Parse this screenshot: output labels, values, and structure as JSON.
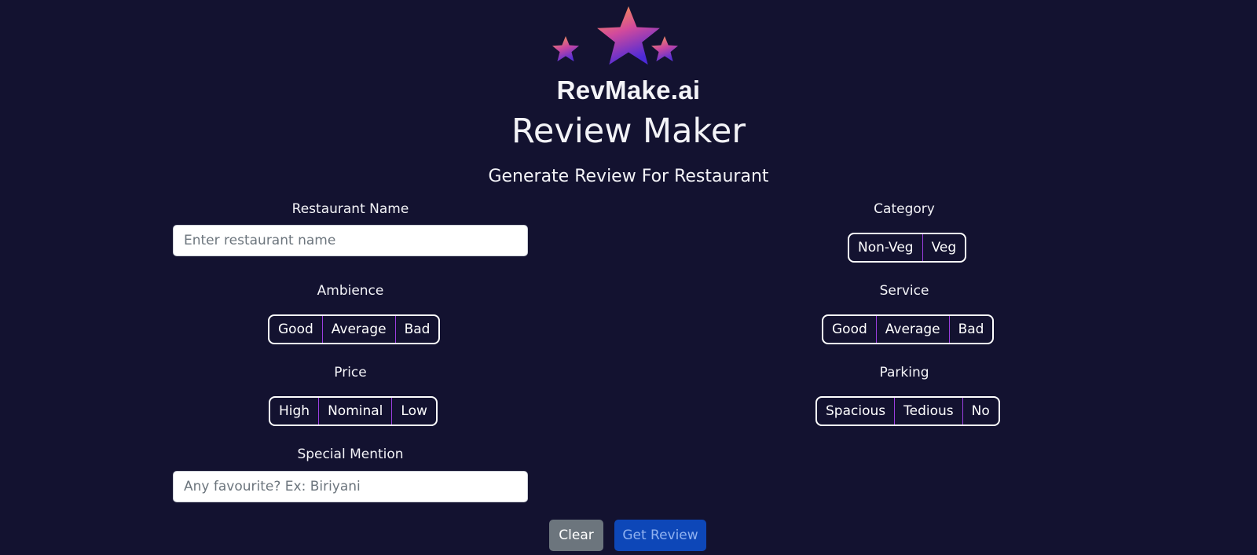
{
  "brand": {
    "name": "RevMake.ai",
    "logo_icon": "three-stars-icon",
    "star_gradient": [
      "#ff9a3c",
      "#c13ea8",
      "#5a2ee0"
    ]
  },
  "header": {
    "title": "Review Maker",
    "subtitle": "Generate Review For Restaurant"
  },
  "form": {
    "restaurant_name": {
      "label": "Restaurant Name",
      "value": "",
      "placeholder": "Enter restaurant name"
    },
    "category": {
      "label": "Category",
      "options": [
        "Non-Veg",
        "Veg"
      ]
    },
    "ambience": {
      "label": "Ambience",
      "options": [
        "Good",
        "Average",
        "Bad"
      ]
    },
    "service": {
      "label": "Service",
      "options": [
        "Good",
        "Average",
        "Bad"
      ]
    },
    "price": {
      "label": "Price",
      "options": [
        "High",
        "Nominal",
        "Low"
      ]
    },
    "parking": {
      "label": "Parking",
      "options": [
        "Spacious",
        "Tedious",
        "No"
      ]
    },
    "special_mention": {
      "label": "Special Mention",
      "value": "",
      "placeholder": "Any favourite? Ex: Biriyani"
    }
  },
  "actions": {
    "clear_label": "Clear",
    "get_review_label": "Get Review"
  },
  "colors": {
    "background": "#131230",
    "segment_divider": "#9b3ee0",
    "clear_button": "#6c757d",
    "get_review_button": "#0d47b8"
  }
}
